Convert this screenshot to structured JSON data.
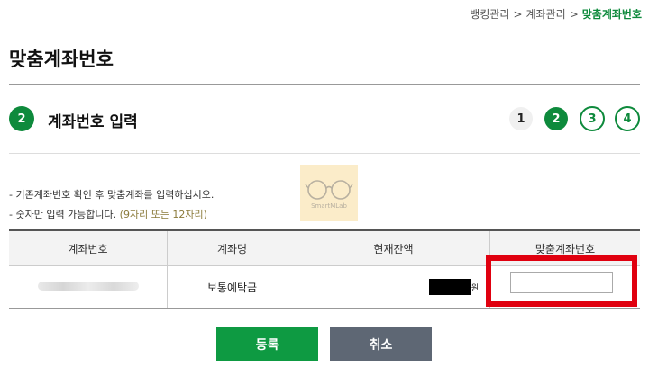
{
  "breadcrumb": {
    "items": [
      "뱅킹관리",
      "계좌관리"
    ],
    "separator": ">",
    "current": "맞춤계좌번호"
  },
  "page": {
    "title": "맞춤계좌번호"
  },
  "step": {
    "current_number": "2",
    "heading": "계좌번호 입력",
    "indicators": [
      "1",
      "2",
      "3",
      "4"
    ],
    "active_index": 2
  },
  "notes": {
    "line1": "- 기존계좌번호 확인 후 맞춤계좌를 입력하십시오.",
    "line2_prefix": "- 숫자만 입력 가능합니다.",
    "line2_hint": "(9자리 또는 12자리)"
  },
  "watermark": {
    "text": "SmartMLab",
    "icon": "glasses-icon"
  },
  "table": {
    "headers": [
      "계좌번호",
      "계좌명",
      "현재잔액",
      "맞춤계좌번호"
    ],
    "row": {
      "account_name": "보통예탁금",
      "balance_unit": "원",
      "custom_account_value": ""
    }
  },
  "buttons": {
    "register": "등록",
    "cancel": "취소"
  },
  "colors": {
    "accent": "#0e8a3c",
    "highlight": "#e0000f",
    "cancel": "#5e6774"
  }
}
